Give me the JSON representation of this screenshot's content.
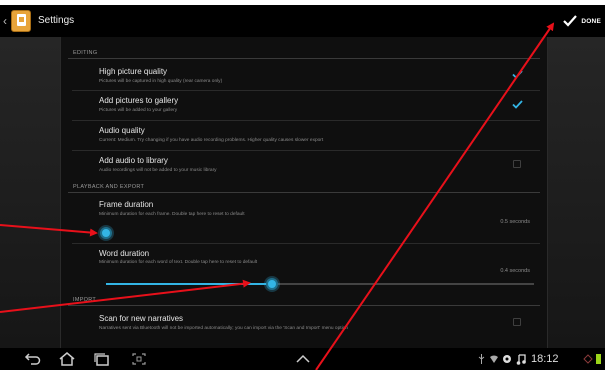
{
  "actionbar": {
    "title": "Settings",
    "done_label": "DONE"
  },
  "sections": {
    "editing": "EDITING",
    "playback": "PLAYBACK AND EXPORT",
    "import": "IMPORT"
  },
  "items": {
    "high_quality": {
      "title": "High picture quality",
      "subtitle": "Pictures will be captured in high quality (rear camera only)",
      "checked": true
    },
    "add_gallery": {
      "title": "Add pictures to gallery",
      "subtitle": "Pictures will be added to your gallery",
      "checked": true
    },
    "audio_quality": {
      "title": "Audio quality",
      "subtitle": "Current: Medium. Try changing if you have audio recording problems. Higher quality causes slower export"
    },
    "add_audio": {
      "title": "Add audio to library",
      "subtitle": "Audio recordings will not be added to your music library",
      "checked": false
    },
    "frame_duration": {
      "title": "Frame duration",
      "subtitle": "Minimum duration for each frame. Double tap here to reset to default",
      "value": "0.5 seconds",
      "slider_fraction": 0.0
    },
    "word_duration": {
      "title": "Word duration",
      "subtitle": "Minimum duration for each word of text. Double tap here to reset to default",
      "value": "0.4 seconds",
      "slider_fraction": 0.37
    },
    "scan_narratives": {
      "title": "Scan for new narratives",
      "subtitle": "Narratives sent via Bluetooth will not be imported automatically; you can import via the 'Scan and Import' menu option",
      "checked": false
    }
  },
  "status": {
    "time": "18:12"
  },
  "colors": {
    "accent": "#33b5e5",
    "annotation": "#e8101a"
  }
}
